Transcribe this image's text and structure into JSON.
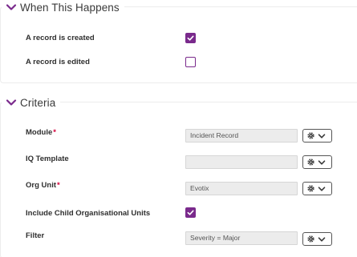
{
  "when_section": {
    "title": "When This Happens",
    "items": [
      {
        "label": "A record is created",
        "checked": true
      },
      {
        "label": "A record is edited",
        "checked": false
      }
    ]
  },
  "criteria_section": {
    "title": "Criteria",
    "module": {
      "label": "Module",
      "required_mark": "*",
      "value": "Incident Record"
    },
    "iq_template": {
      "label": "IQ Template",
      "value": ""
    },
    "org_unit": {
      "label": "Org Unit",
      "required_mark": "*",
      "value": "Evotix"
    },
    "include_child": {
      "label": "Include Child Organisational Units",
      "checked": true
    },
    "filter": {
      "label": "Filter",
      "value": "Severity = Major"
    }
  },
  "colors": {
    "accent": "#7a2a8c",
    "required": "#d4003b",
    "field_bg": "#ececec"
  },
  "icons": {
    "collapse": "chevron-down-icon",
    "settings": "gear-icon",
    "dropdown": "chevron-down-icon"
  }
}
